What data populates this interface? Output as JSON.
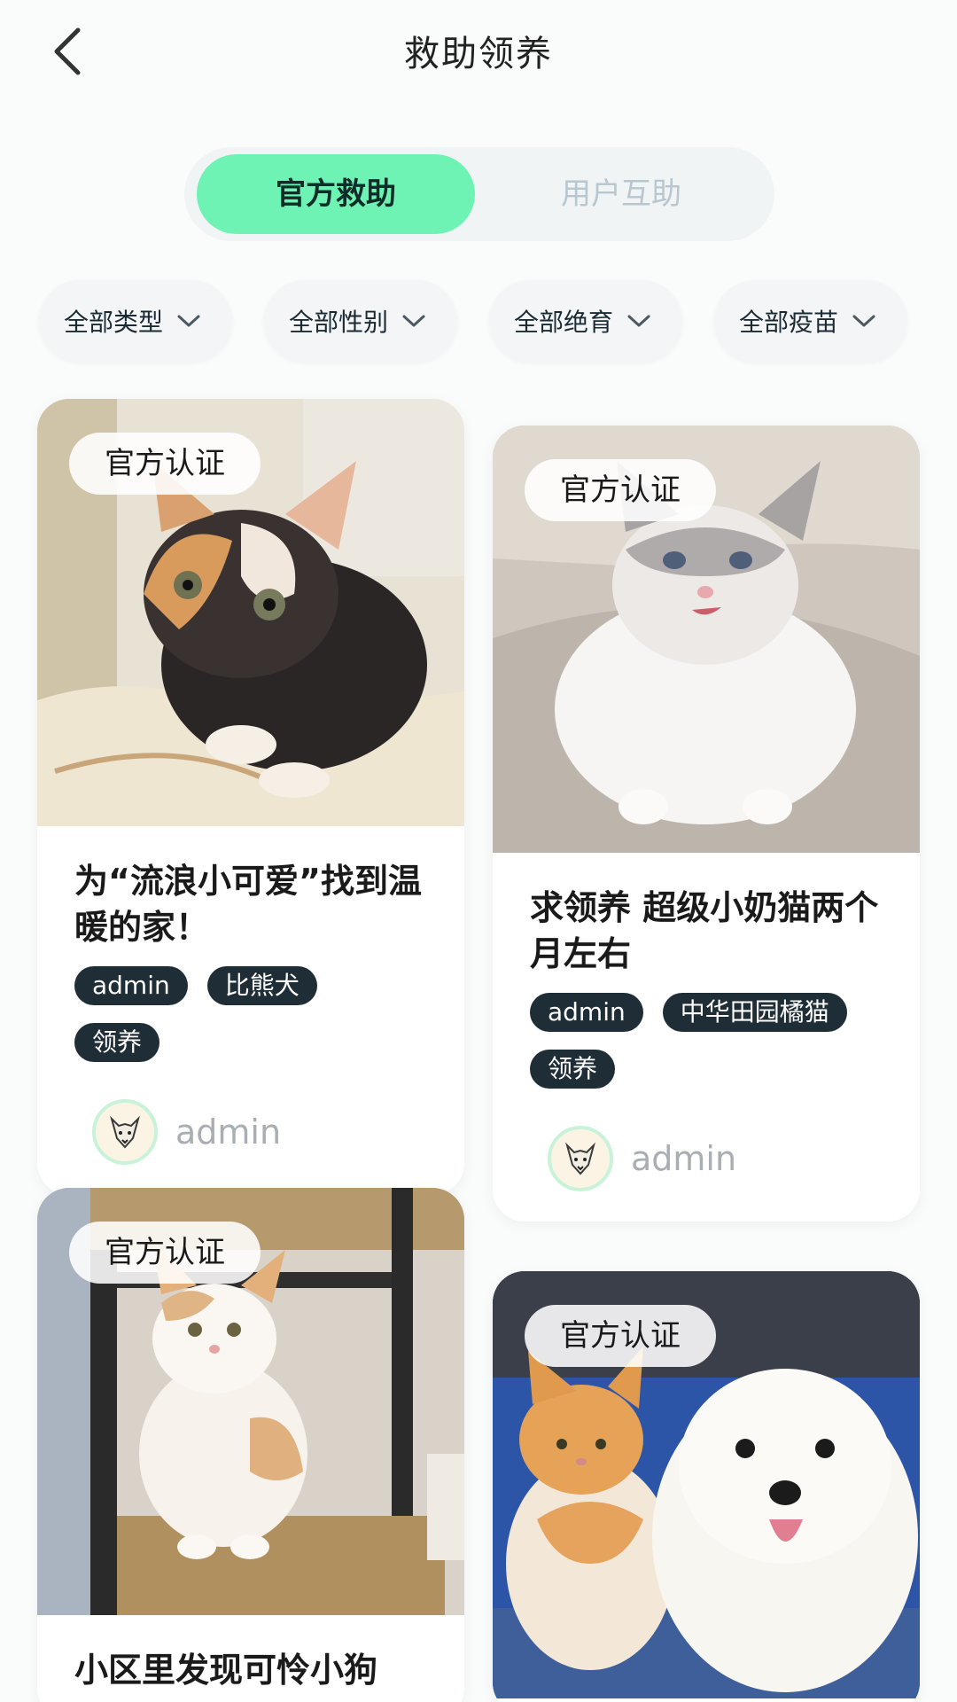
{
  "header": {
    "title": "救助领养"
  },
  "tabs": [
    {
      "label": "官方救助",
      "active": true
    },
    {
      "label": "用户互助",
      "active": false
    }
  ],
  "filters": [
    {
      "label": "全部类型"
    },
    {
      "label": "全部性别"
    },
    {
      "label": "全部绝育"
    },
    {
      "label": "全部疫苗"
    }
  ],
  "cards": [
    {
      "badge": "官方认证",
      "title": "为“流浪小可爱”找到温暖的家！",
      "tags": [
        "admin",
        "比熊犬",
        "领养"
      ],
      "author": "admin"
    },
    {
      "badge": "官方认证",
      "title": "求领养 超级小奶猫两个月左右",
      "tags": [
        "admin",
        "中华田园橘猫",
        "领养"
      ],
      "author": "admin"
    },
    {
      "badge": "官方认证",
      "title": "小区里发现可怜小狗",
      "tags": [],
      "author": ""
    },
    {
      "badge": "官方认证",
      "title": "",
      "tags": [],
      "author": ""
    }
  ],
  "colors": {
    "accent": "#6ff3b5",
    "tag_bg": "#1f2d36",
    "muted_text": "#b7c6cf"
  }
}
